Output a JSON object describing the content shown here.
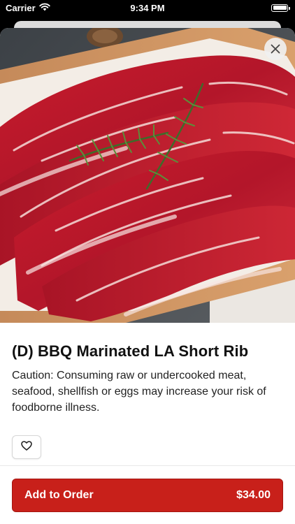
{
  "status_bar": {
    "carrier": "Carrier",
    "time": "9:34 PM"
  },
  "item": {
    "title": "(D) BBQ Marinated LA Short Rib",
    "description": "Caution: Consuming raw or undercooked meat, seafood, shellfish or eggs may increase your risk of foodborne illness."
  },
  "actions": {
    "add_label": "Add to Order",
    "price": "$34.00"
  },
  "icons": {
    "close": "close-icon",
    "favorite": "heart-icon",
    "wifi": "wifi-icon",
    "battery": "battery-icon"
  },
  "colors": {
    "accent": "#c8201a",
    "sheet_background": "#ffffff",
    "screen_background": "#000000"
  }
}
